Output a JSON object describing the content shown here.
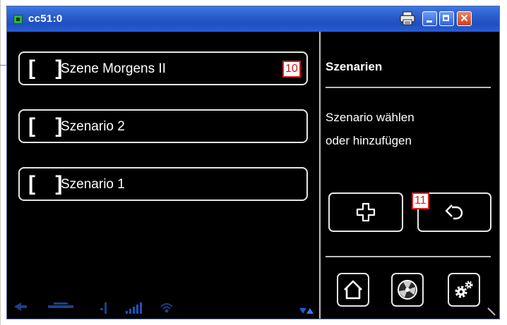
{
  "window": {
    "title": "cc51:0",
    "colors": {
      "titlebar": "#2d5fd0",
      "background": "#000000",
      "close": "#c8401c"
    }
  },
  "scenes": [
    {
      "brackets": "[ ]",
      "label": "Szene Morgens II",
      "badge": "10"
    },
    {
      "brackets": "[ ]",
      "label": "Szenario 2"
    },
    {
      "brackets": "[ ]",
      "label": "Szenario 1"
    }
  ],
  "side_panel": {
    "title": "Szenarien",
    "line1": "Szenario wählen",
    "line2": "oder hinzufügen",
    "add_icon": "plus-icon",
    "back_icon": "back-arrow-icon",
    "back_badge": "11"
  },
  "nav": {
    "home_icon": "home-icon",
    "fan_icon": "fan-icon",
    "settings_icon": "gear-icon"
  },
  "statusbar": {
    "icons": [
      "arrow-icon",
      "network-icon",
      "antenna-icon",
      "signal-icon",
      "wifi-icon",
      "updown-icon"
    ]
  }
}
